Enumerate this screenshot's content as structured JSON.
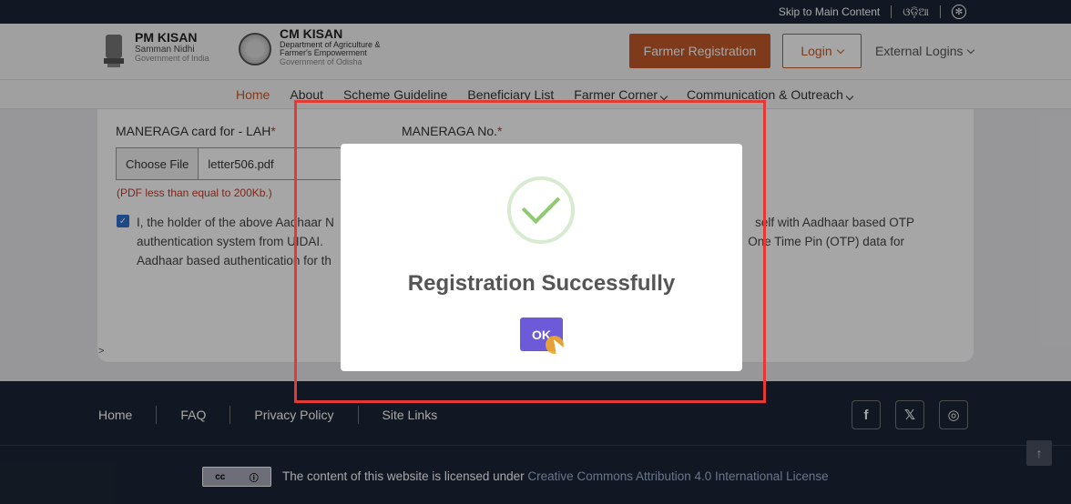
{
  "topbar": {
    "skip_label": "Skip to Main Content",
    "lang_label": "ଓଡ଼ିଆ"
  },
  "header": {
    "logo1": {
      "title": "PM KISAN",
      "subtitle": "Samman Nidhi",
      "govt": "Government of India"
    },
    "logo2": {
      "title": "CM KISAN",
      "dept_line1": "Department of Agriculture &",
      "dept_line2": "Farmer's Empowerment",
      "govt": "Government of Odisha"
    },
    "farmer_registration": "Farmer Registration",
    "login": "Login",
    "external_logins": "External Logins"
  },
  "nav": {
    "items": [
      "Home",
      "About",
      "Scheme Guideline",
      "Beneficiary List",
      "Farmer Corner",
      "Communication & Outreach"
    ]
  },
  "form": {
    "manerega_card_label": "MANERAGA card for - LAH",
    "manerega_no_label": "MANERAGA No.",
    "choose_file": "Choose File",
    "file_name": "letter506.pdf",
    "file_hint": "(PDF less than equal to 200Kb.)",
    "consent_text": "I, the holder of the above Aadhaar N... self with Aadhaar based OTP authentication system from UIDAI. ... One Time Pin (OTP) data for Aadhaar based authentication for th...",
    "consent_line1a": "I, the holder of the above Aadhaar N",
    "consent_line1b": "self with Aadhaar based OTP",
    "consent_line2a": "authentication system from UIDAI.",
    "consent_line2b": "One Time Pin (OTP) data for",
    "consent_line3": "Aadhaar based authentication for th"
  },
  "modal": {
    "title": "Registration Successfully",
    "ok_label": "OK"
  },
  "footer": {
    "links": [
      "Home",
      "FAQ",
      "Privacy Policy",
      "Site Links"
    ],
    "license_prefix": "The content of this website is licensed under",
    "license_link": "Creative Commons Attribution 4.0 International License"
  },
  "colors": {
    "accent": "#c45a2a",
    "footer_bg": "#1d2636",
    "ok_button": "#6d5ad8",
    "success_check": "#8dcc6e",
    "highlight": "#e53935"
  }
}
